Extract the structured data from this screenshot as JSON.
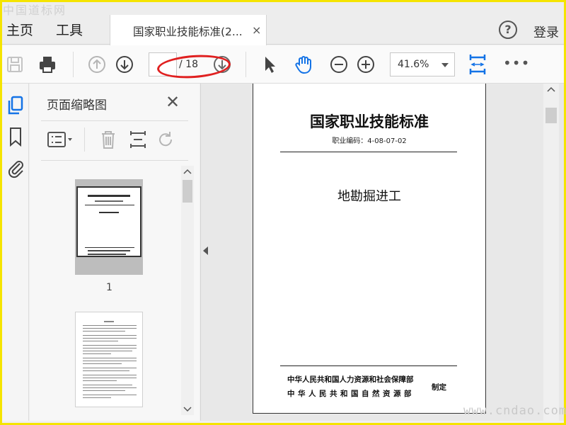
{
  "watermarks": {
    "top": "中国道标网",
    "bottom": "www.cndao.com"
  },
  "nav": {
    "home": "主页",
    "tools": "工具",
    "help": "?",
    "login": "登录"
  },
  "tab": {
    "title": "国家职业技能标准(2...",
    "close": "×"
  },
  "toolbar": {
    "page_current": "",
    "page_count": "/ 18",
    "zoom": "41.6%",
    "more": "•••"
  },
  "thumbnails": {
    "title": "页面缩略图",
    "close": "✕",
    "items": [
      {
        "number": "1"
      }
    ]
  },
  "document": {
    "title": "国家职业技能标准",
    "code": "职业编码：4-08-07-02",
    "name": "地勘掘进工",
    "publisher_1": "中华人民共和国人力资源和社会保障部",
    "publisher_2": "中华人民共和国自然资源部",
    "issued": "制定"
  },
  "colors": {
    "accent": "#1473e6",
    "annotation": "#e02020",
    "frame": "#f5e400"
  }
}
